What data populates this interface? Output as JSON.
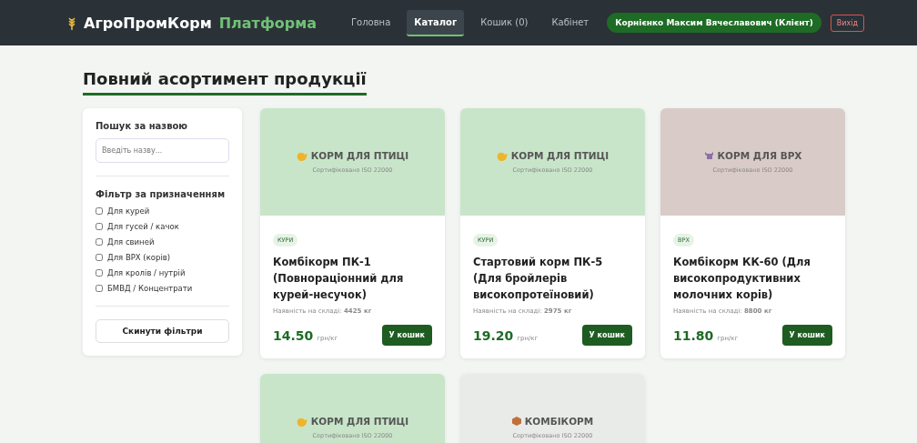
{
  "brand": {
    "name": "АгроПромКорм",
    "suffix": "Платформа"
  },
  "nav": [
    {
      "label": "Головна",
      "selected": false
    },
    {
      "label": "Каталог",
      "selected": true
    },
    {
      "label": "Кошик (0)",
      "selected": false
    },
    {
      "label": "Кабінет",
      "selected": false
    }
  ],
  "user": "Корнієнко Максим Вячеславович (Клієнт)",
  "logout": "Вихід",
  "page_title": "Повний асортимент продукції",
  "filters": {
    "search_title": "Пошук за назвою",
    "search_placeholder": "Введіть назву...",
    "purpose_title": "Фільтр за призначенням",
    "options": [
      {
        "label": "Для курей",
        "checked": false
      },
      {
        "label": "Для гусей / качок",
        "checked": false
      },
      {
        "label": "Для свиней",
        "checked": false
      },
      {
        "label": "Для ВРХ (корів)",
        "checked": false
      },
      {
        "label": "Для кролів / нутрій",
        "checked": false
      },
      {
        "label": "БМВД / Концентрати",
        "checked": false
      }
    ],
    "reset": "Скинути фільтри"
  },
  "products": [
    {
      "kind": "poultry",
      "image_label": "КОРМ ДЛЯ ПТИЦІ",
      "certificate": "Сертифіковано ISO 22000",
      "tag": "КУРИ",
      "name": "Комбікорм ПК-1 (Повнораціонний для курей-несучок)",
      "stock_label": "Наявність на складі:",
      "stock": "4425 кг",
      "price": "14.50",
      "unit": "грн/кг",
      "button": "У кошик"
    },
    {
      "kind": "poultry",
      "image_label": "КОРМ ДЛЯ ПТИЦІ",
      "certificate": "Сертифіковано ISO 22000",
      "tag": "КУРИ",
      "name": "Стартовий корм ПК-5 (Для бройлерів високопротеїновий)",
      "stock_label": "Наявність на складі:",
      "stock": "2975 кг",
      "price": "19.20",
      "unit": "грн/кг",
      "button": "У кошик"
    },
    {
      "kind": "cattle",
      "image_label": "КОРМ ДЛЯ ВРХ",
      "certificate": "Сертифіковано ISO 22000",
      "tag": "ВРХ",
      "name": "Комбікорм КК-60 (Для високопродуктивних молочних корів)",
      "stock_label": "Наявність на складі:",
      "stock": "8800 кг",
      "price": "11.80",
      "unit": "грн/кг",
      "button": "У кошик"
    },
    {
      "kind": "poultry",
      "image_label": "КОРМ ДЛЯ ПТИЦІ",
      "certificate": "Сертифіковано ISO 22000"
    },
    {
      "kind": "compound",
      "image_label": "КОМБІКОРМ",
      "certificate": "Сертифіковано ISO 22000"
    }
  ]
}
